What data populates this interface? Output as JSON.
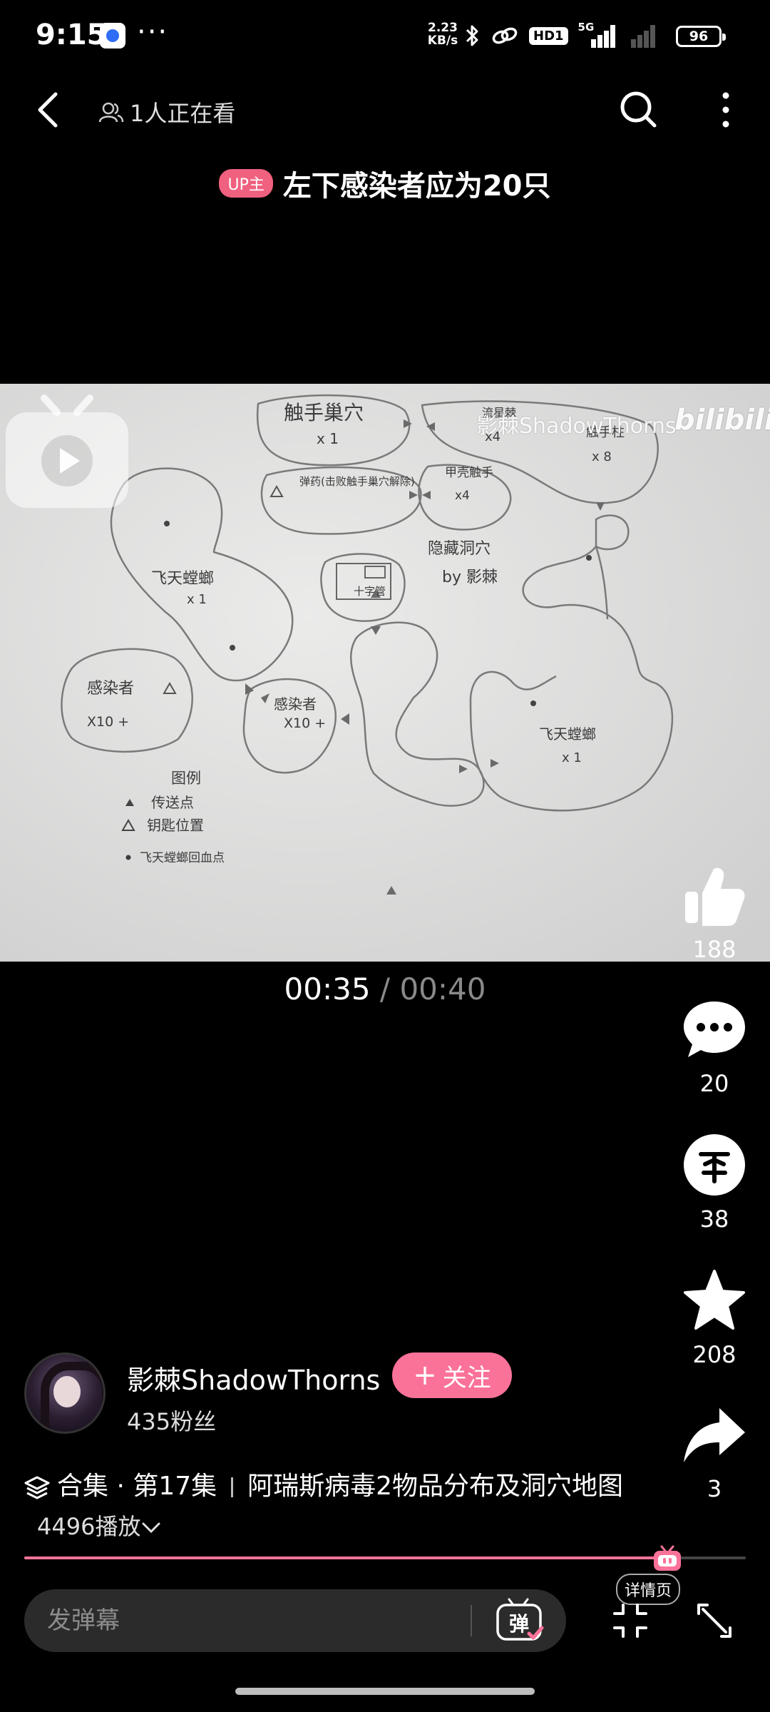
{
  "status_bar": {
    "time": "9:15",
    "dots": "···",
    "net_speed_value": "2.23",
    "net_speed_unit": "KB/s",
    "hd_label": "HD1",
    "network_label": "5G",
    "battery": "96"
  },
  "nav": {
    "viewers": "1人正在看"
  },
  "video": {
    "up_badge": "UP主",
    "title": "左下感染者应为20只",
    "watermark": "影棘ShadowThorns",
    "logo_text": "bilibili",
    "current_time": "00:35",
    "time_separator": "/",
    "total_time": "00:40",
    "progress": 0.89,
    "map": {
      "nest": "触手巢穴",
      "nest_count": "x 1",
      "flower_label": "流星棘",
      "flower_count": "x4",
      "tentacle_pillar": "触手柱",
      "pillar_count": "x 8",
      "ammo": "弹药(击败触手巢穴解除)",
      "armor_tentacle": "甲壳触手",
      "armor_count": "x4",
      "hidden_cave": "隐藏洞穴",
      "by_author": "by 影棘",
      "cross_key": "十字管",
      "flying_mantis_1": "飞天螳螂",
      "flying_mantis_1_count": "x 1",
      "infected_left": "感染者",
      "infected_left_count": "X10 +",
      "infected_mid": "感染者",
      "infected_mid_count": "X10 +",
      "flying_mantis_2": "飞天螳螂",
      "flying_mantis_2_count": "x 1",
      "legend_title": "图例",
      "legend_teleport": "传送点",
      "legend_key": "钥匙位置",
      "legend_respawn": "飞天螳螂回血点"
    }
  },
  "actions": {
    "like_count": "188",
    "comment_count": "20",
    "coin_count": "38",
    "favorite_count": "208",
    "share_count": "3"
  },
  "uploader": {
    "name": "影棘ShadowThorns",
    "follow_label": "关注",
    "follow_plus": "+",
    "fans": "435粉丝"
  },
  "collection": {
    "label": "合集 · 第17集",
    "title": "阿瑞斯病毒2物品分布及洞穴地图",
    "plays": "4496播放"
  },
  "bottom": {
    "detail_label": "详情页",
    "danmaku_placeholder": "发弹幕",
    "danmaku_toggle": "弹"
  },
  "colors": {
    "accent": "#fb7299",
    "up_badge": "#f0607f",
    "background": "#000000"
  }
}
